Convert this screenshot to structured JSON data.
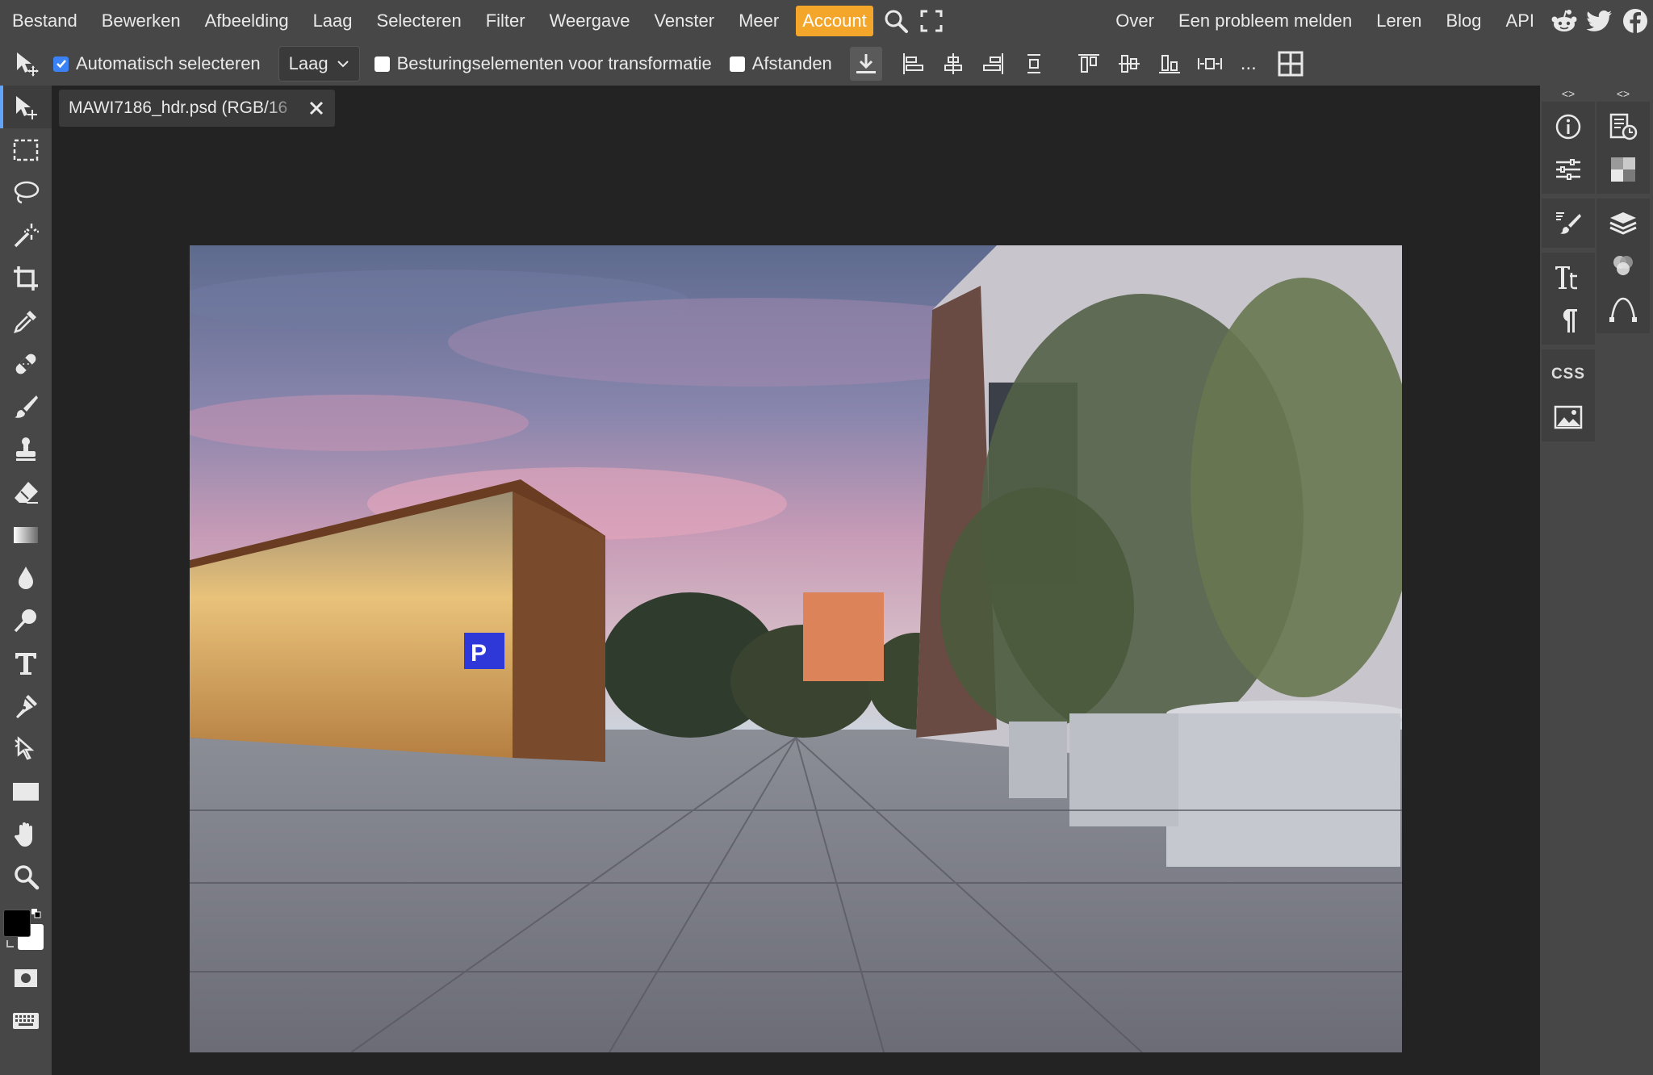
{
  "menu": {
    "items": [
      "Bestand",
      "Bewerken",
      "Afbeelding",
      "Laag",
      "Selecteren",
      "Filter",
      "Weergave",
      "Venster",
      "Meer"
    ],
    "account": "Account",
    "right_items": [
      "Over",
      "Een probleem melden",
      "Leren",
      "Blog",
      "API"
    ]
  },
  "options": {
    "auto_select_label": "Automatisch selecteren",
    "auto_select_checked": true,
    "layer_select_value": "Laag",
    "transform_controls_label": "Besturingselementen voor transformatie",
    "transform_controls_checked": false,
    "distances_label": "Afstanden",
    "distances_checked": false,
    "more_label": "..."
  },
  "document": {
    "tab_title": "MAWI7186_hdr.psd (RGB/16"
  },
  "tools": [
    "move-tool",
    "marquee-tool",
    "lasso-tool",
    "magic-wand-tool",
    "crop-tool",
    "eyedropper-tool",
    "healing-tool",
    "brush-tool",
    "clone-stamp-tool",
    "eraser-tool",
    "gradient-tool",
    "blur-tool",
    "dodge-tool",
    "type-tool",
    "pen-tool",
    "path-select-tool",
    "rectangle-tool",
    "hand-tool",
    "zoom-tool"
  ],
  "colors": {
    "foreground": "#000000",
    "background": "#ffffff",
    "accent": "#f4a62a",
    "active_tool": "#60a5fa"
  },
  "right_panel": {
    "collapse_label": "<>",
    "css_label": "CSS"
  }
}
